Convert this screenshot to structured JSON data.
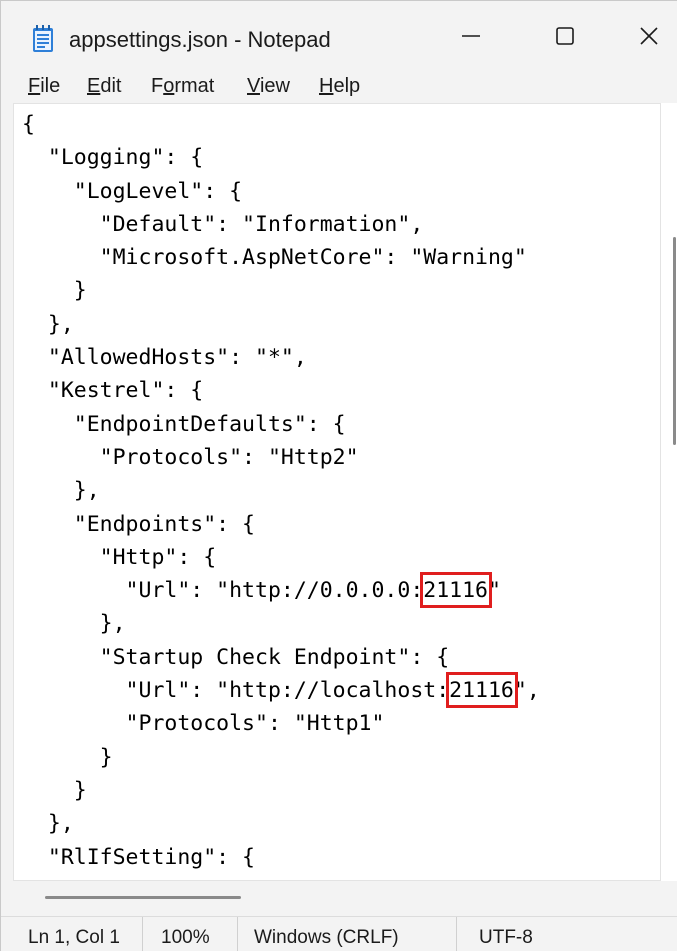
{
  "window": {
    "title": "appsettings.json - Notepad",
    "accent_color": "#e01e1e"
  },
  "menu": {
    "file": {
      "label_u": "F",
      "label_rest": "ile"
    },
    "edit": {
      "label_u": "E",
      "label_rest": "dit"
    },
    "format": {
      "label_pre": "F",
      "label_u": "o",
      "label_rest": "rmat"
    },
    "view": {
      "label_u": "V",
      "label_rest": "iew"
    },
    "help": {
      "label_u": "H",
      "label_rest": "elp"
    }
  },
  "editor": {
    "lines": [
      {
        "text": "{"
      },
      {
        "text": "  \"Logging\": {"
      },
      {
        "text": "    \"LogLevel\": {"
      },
      {
        "text": "      \"Default\": \"Information\","
      },
      {
        "text": "      \"Microsoft.AspNetCore\": \"Warning\""
      },
      {
        "text": "    }"
      },
      {
        "text": "  },"
      },
      {
        "text": "  \"AllowedHosts\": \"*\","
      },
      {
        "text": "  \"Kestrel\": {"
      },
      {
        "text": "    \"EndpointDefaults\": {"
      },
      {
        "text": "      \"Protocols\": \"Http2\""
      },
      {
        "text": "    },"
      },
      {
        "text": "    \"Endpoints\": {"
      },
      {
        "text": "      \"Http\": {"
      },
      {
        "pre": "        \"Url\": \"http://0.0.0.0:",
        "hl": "21116",
        "post": "\""
      },
      {
        "text": "      },"
      },
      {
        "text": "      \"Startup Check Endpoint\": {"
      },
      {
        "pre": "        \"Url\": \"http://localhost:",
        "hl": "21116",
        "post": "\","
      },
      {
        "text": "        \"Protocols\": \"Http1\""
      },
      {
        "text": "      }"
      },
      {
        "text": "    }"
      },
      {
        "text": "  },"
      },
      {
        "text": "  \"RlIfSetting\": {"
      }
    ]
  },
  "status": {
    "position": "Ln 1, Col 1",
    "zoom": "100%",
    "line_ending": "Windows (CRLF)",
    "encoding": "UTF-8"
  },
  "icons": [
    "notepad-icon",
    "minimize-icon",
    "maximize-icon",
    "close-icon"
  ]
}
